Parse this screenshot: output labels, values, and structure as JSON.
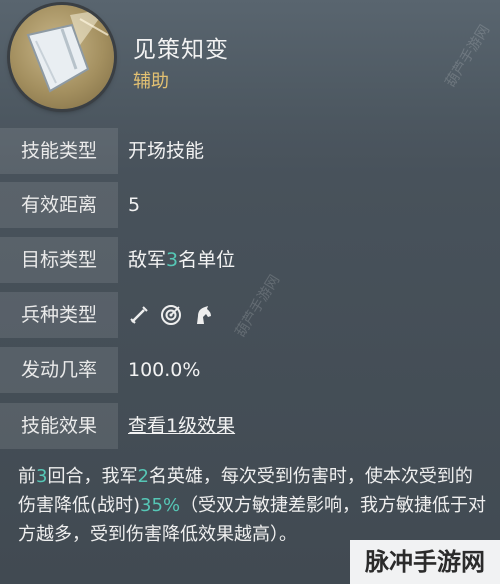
{
  "skill": {
    "name": "见策知变",
    "tag": "辅助"
  },
  "rows": [
    {
      "label": "技能类型",
      "value": "开场技能"
    },
    {
      "label": "有效距离",
      "value": "5"
    },
    {
      "label": "目标类型",
      "value_pre": "敌军",
      "value_num": "3",
      "value_post": "名单位"
    },
    {
      "label": "兵种类型",
      "icons": [
        "sword-icon",
        "bow-target-icon",
        "horse-head-icon"
      ]
    },
    {
      "label": "发动几率",
      "value": "100.0%"
    },
    {
      "label": "技能效果",
      "value": "查看1级效果"
    }
  ],
  "description": {
    "p1": "前",
    "n1": "3",
    "p2": "回合，我军",
    "n2": "2",
    "p3": "名英雄，每次受到伤害时，使本次受到的伤害降低(战时)",
    "n3": "35%",
    "p4": "（受双方敏捷差影响，我方敏捷低于对方越多，受到伤害降低效果越高）。"
  },
  "watermarks": {
    "corner": "脉冲手游网",
    "diag_top": "葫芦手游网",
    "diag_mid": "葫芦手游网"
  },
  "colors": {
    "highlight": "#56c7b6",
    "tag": "#e3c172",
    "link": "#4fb8c0"
  }
}
